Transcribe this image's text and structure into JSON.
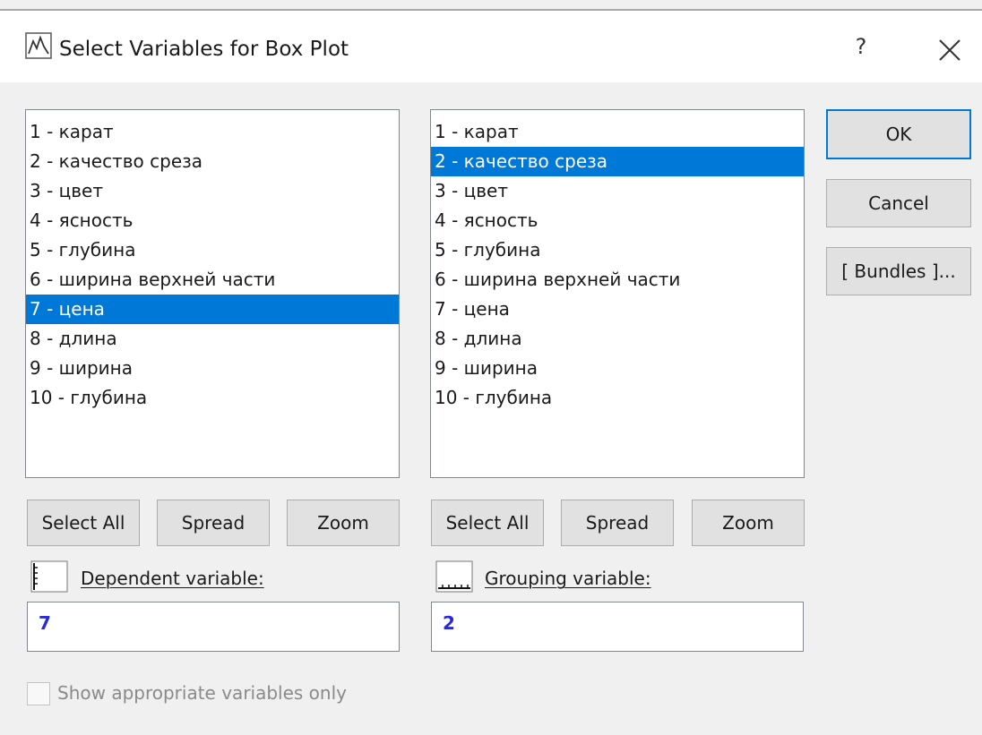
{
  "window": {
    "title": "Select Variables for Box Plot",
    "help_label": "?"
  },
  "left_list": {
    "items": [
      {
        "label": "1 - карат",
        "selected": false
      },
      {
        "label": "2 - качество среза",
        "selected": false
      },
      {
        "label": "3 - цвет",
        "selected": false
      },
      {
        "label": "4 - ясность",
        "selected": false
      },
      {
        "label": "5 - глубина",
        "selected": false
      },
      {
        "label": "6 - ширина верхней части",
        "selected": false
      },
      {
        "label": "7 - цена",
        "selected": true
      },
      {
        "label": "8 - длина",
        "selected": false
      },
      {
        "label": "9 - ширина",
        "selected": false
      },
      {
        "label": "10 - глубина",
        "selected": false
      }
    ],
    "buttons": {
      "select_all": "Select All",
      "spread": "Spread",
      "zoom": "Zoom"
    },
    "variable_label": "Dependent variable:",
    "variable_value": "7"
  },
  "right_list": {
    "items": [
      {
        "label": "1 - карат",
        "selected": false
      },
      {
        "label": "2 - качество среза",
        "selected": true
      },
      {
        "label": "3 - цвет",
        "selected": false
      },
      {
        "label": "4 - ясность",
        "selected": false
      },
      {
        "label": "5 - глубина",
        "selected": false
      },
      {
        "label": "6 - ширина верхней части",
        "selected": false
      },
      {
        "label": "7 - цена",
        "selected": false
      },
      {
        "label": "8 - длина",
        "selected": false
      },
      {
        "label": "9 - ширина",
        "selected": false
      },
      {
        "label": "10 - глубина",
        "selected": false
      }
    ],
    "buttons": {
      "select_all": "Select All",
      "spread": "Spread",
      "zoom": "Zoom"
    },
    "variable_label": "Grouping variable:",
    "variable_value": "2"
  },
  "actions": {
    "ok": "OK",
    "cancel": "Cancel",
    "bundles": "[ Bundles ]..."
  },
  "options": {
    "show_appropriate_label": "Show appropriate variables only",
    "show_appropriate_checked": false,
    "enabled": false
  },
  "colors": {
    "selection": "#0078d7",
    "value_text": "#2a2ad6",
    "dialog_bg": "#f0f0f0"
  }
}
